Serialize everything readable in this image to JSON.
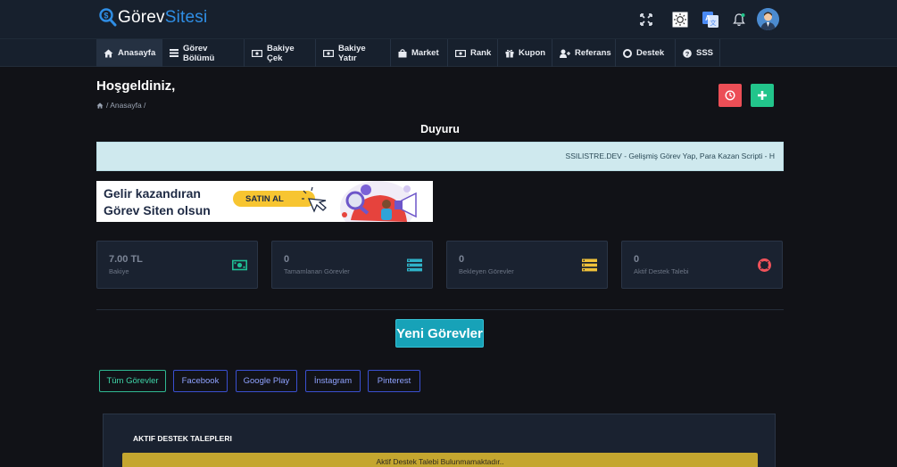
{
  "brand": {
    "part1": "Görev",
    "part2": "Sitesi"
  },
  "nav": [
    {
      "label": "Anasayfa",
      "icon": "home-icon"
    },
    {
      "label": "Görev Bölümü",
      "icon": "list-icon"
    },
    {
      "label": "Bakiye Çek",
      "icon": "money-icon"
    },
    {
      "label": "Bakiye Yatır",
      "icon": "money-icon"
    },
    {
      "label": "Market",
      "icon": "shopping-bag-icon"
    },
    {
      "label": "Rank",
      "icon": "money-icon"
    },
    {
      "label": "Kupon",
      "icon": "gift-icon"
    },
    {
      "label": "Referans",
      "icon": "user-plus-icon"
    },
    {
      "label": "Destek",
      "icon": "lifebuoy-icon"
    },
    {
      "label": "SSS",
      "icon": "question-icon"
    }
  ],
  "page": {
    "title": "Hoşgeldiniz,",
    "breadcrumb": "/ Anasayfa /"
  },
  "announcement": {
    "title": "Duyuru",
    "text": "SSILISTRE.DEV - Gelişmiş Görev Yap, Para Kazan Scripti - H"
  },
  "banner": {
    "line1": "Gelir kazandıran",
    "line2": "Görev Siten olsun",
    "cta": "SATIN AL"
  },
  "stats": [
    {
      "value": "7.00 TL",
      "label": "Bakiye",
      "icon": "money-bill-icon",
      "color": "#1fbf95"
    },
    {
      "value": "0",
      "label": "Tamamlanan Görevler",
      "icon": "tasks-icon",
      "color": "#2fb3c9"
    },
    {
      "value": "0",
      "label": "Bekleyen Görevler",
      "icon": "pending-tasks-icon",
      "color": "#f0c23a"
    },
    {
      "value": "0",
      "label": "Aktif Destek Talebi",
      "icon": "lifebuoy-icon",
      "color": "#f0525a"
    }
  ],
  "new_tasks_label": "Yeni Görevler",
  "filters": [
    "Tüm Görevler",
    "Facebook",
    "Google Play",
    "İnstagram",
    "Pinterest"
  ],
  "support": {
    "title": "AKTIF DESTEK TALEPLERI",
    "empty": "Aktif Destek Talebi Bulunmamaktadır.."
  },
  "colors": {
    "accent": "#17a2b8",
    "danger": "#f0525a",
    "success": "#22c58b",
    "warning": "#c4a62f"
  }
}
